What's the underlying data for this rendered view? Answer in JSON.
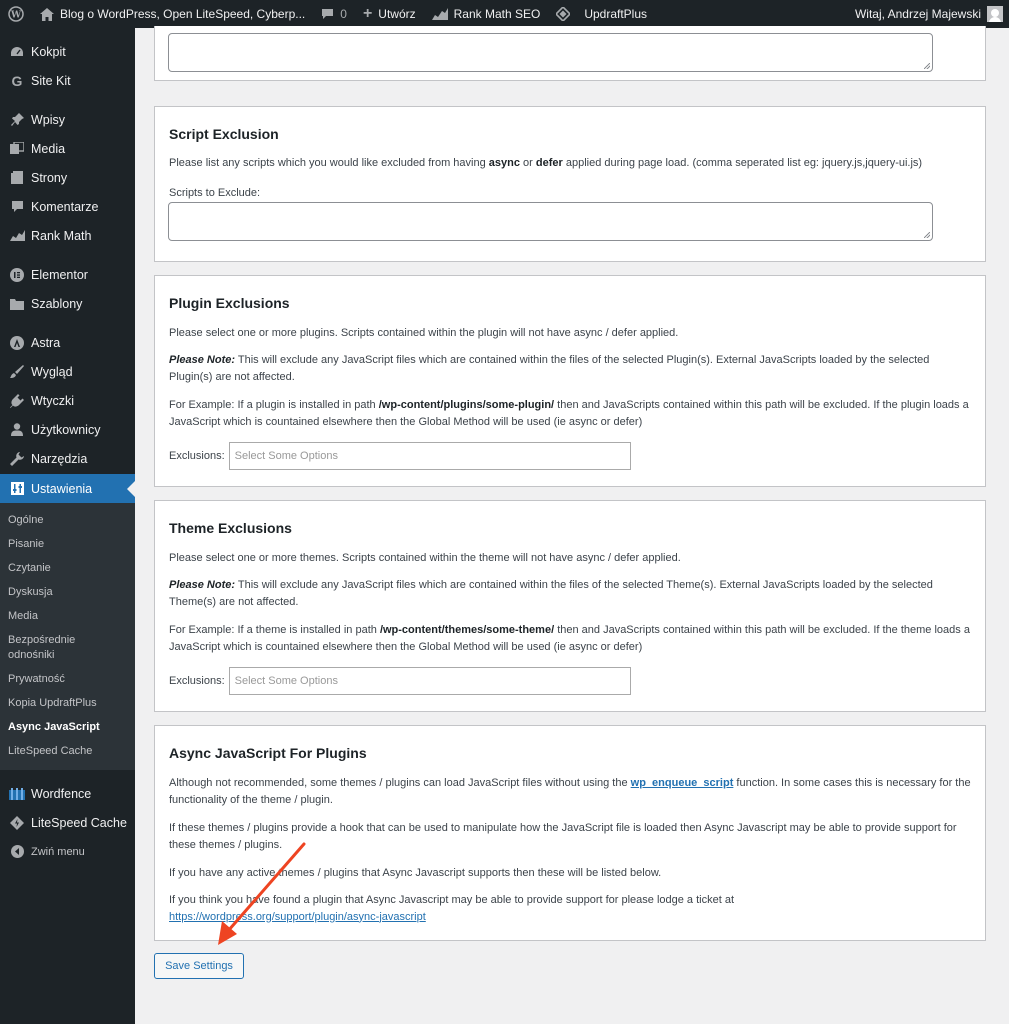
{
  "adminbar": {
    "site_title": "Blog o WordPress, Open LiteSpeed, Cyberp...",
    "comments_count": "0",
    "new_label": "Utwórz",
    "rankmath_label": "Rank Math SEO",
    "updraft_label": "UpdraftPlus",
    "greeting": "Witaj, Andrzej Majewski"
  },
  "sidebar": {
    "items": [
      {
        "label": "Kokpit",
        "icon": "dashboard-icon"
      },
      {
        "label": "Site Kit",
        "icon": "google-g-icon"
      },
      {
        "label": "Wpisy",
        "icon": "pin-icon"
      },
      {
        "label": "Media",
        "icon": "media-icon"
      },
      {
        "label": "Strony",
        "icon": "pages-icon"
      },
      {
        "label": "Komentarze",
        "icon": "comment-icon"
      },
      {
        "label": "Rank Math",
        "icon": "rank-math-icon"
      },
      {
        "label": "Elementor",
        "icon": "elementor-icon"
      },
      {
        "label": "Szablony",
        "icon": "folder-icon"
      },
      {
        "label": "Astra",
        "icon": "astra-icon"
      },
      {
        "label": "Wygląd",
        "icon": "brush-icon"
      },
      {
        "label": "Wtyczki",
        "icon": "plugin-icon"
      },
      {
        "label": "Użytkownicy",
        "icon": "user-icon"
      },
      {
        "label": "Narzędzia",
        "icon": "wrench-icon"
      },
      {
        "label": "Ustawienia",
        "icon": "settings-icon"
      }
    ],
    "submenu": [
      "Ogólne",
      "Pisanie",
      "Czytanie",
      "Dyskusja",
      "Media",
      "Bezpośrednie odnośniki",
      "Prywatność",
      "Kopia UpdraftPlus",
      "Async JavaScript",
      "LiteSpeed Cache"
    ],
    "bottom": [
      {
        "label": "Wordfence",
        "icon": "wordfence-icon"
      },
      {
        "label": "LiteSpeed Cache",
        "icon": "litespeed-icon"
      },
      {
        "label": "Zwiń menu",
        "icon": "collapse-icon"
      }
    ]
  },
  "script_exclusion": {
    "title": "Script Exclusion",
    "desc_1": "Please list any scripts which you would like excluded from having ",
    "desc_async": "async",
    "desc_or": " or ",
    "desc_defer": "defer",
    "desc_2": " applied during page load. (comma seperated list eg: jquery.js,jquery-ui.js)",
    "field_label": "Scripts to Exclude:"
  },
  "plugin_exclusions": {
    "title": "Plugin Exclusions",
    "desc": "Please select one or more plugins. Scripts contained within the plugin will not have async / defer applied.",
    "note_label": "Please Note:",
    "note": " This will exclude any JavaScript files which are contained within the files of the selected Plugin(s). External JavaScripts loaded by the selected Plugin(s) are not affected.",
    "example_1": "For Example: If a plugin is installed in path ",
    "example_path": "/wp-content/plugins/some-plugin/",
    "example_2": " then and JavaScripts contained within this path will be excluded. If the plugin loads a JavaScript which is countained elsewhere then the Global Method will be used (ie async or defer)",
    "select_label": "Exclusions:",
    "select_placeholder": "Select Some Options"
  },
  "theme_exclusions": {
    "title": "Theme Exclusions",
    "desc": "Please select one or more themes. Scripts contained within the theme will not have async / defer applied.",
    "note_label": "Please Note:",
    "note": " This will exclude any JavaScript files which are contained within the files of the selected Theme(s). External JavaScripts loaded by the selected Theme(s) are not affected.",
    "example_1": "For Example: If a theme is installed in path ",
    "example_path": "/wp-content/themes/some-theme/",
    "example_2": " then and JavaScripts contained within this path will be excluded. If the theme loads a JavaScript which is countained elsewhere then the Global Method will be used (ie async or defer)",
    "select_label": "Exclusions:",
    "select_placeholder": "Select Some Options"
  },
  "async_plugins": {
    "title": "Async JavaScript For Plugins",
    "p1_a": "Although not recommended, some themes / plugins can load JavaScript files without using the ",
    "p1_link": "wp_enqueue_script",
    "p1_b": " function. In some cases this is necessary for the functionality of the theme / plugin.",
    "p2": "If these themes / plugins provide a hook that can be used to manipulate how the JavaScript file is loaded then Async Javascript may be able to provide support for these themes / plugins.",
    "p3": "If you have any active themes / plugins that Async Javascript supports then these will be listed below.",
    "p4": "If you think you have found a plugin that Async Javascript may be able to provide support for please lodge a ticket at",
    "p4_link": "https://wordpress.org/support/plugin/async-javascript"
  },
  "save_button": "Save Settings",
  "colors": {
    "accent": "#2271b1",
    "arrow": "#ee4422",
    "adminbar": "#1d2327"
  }
}
